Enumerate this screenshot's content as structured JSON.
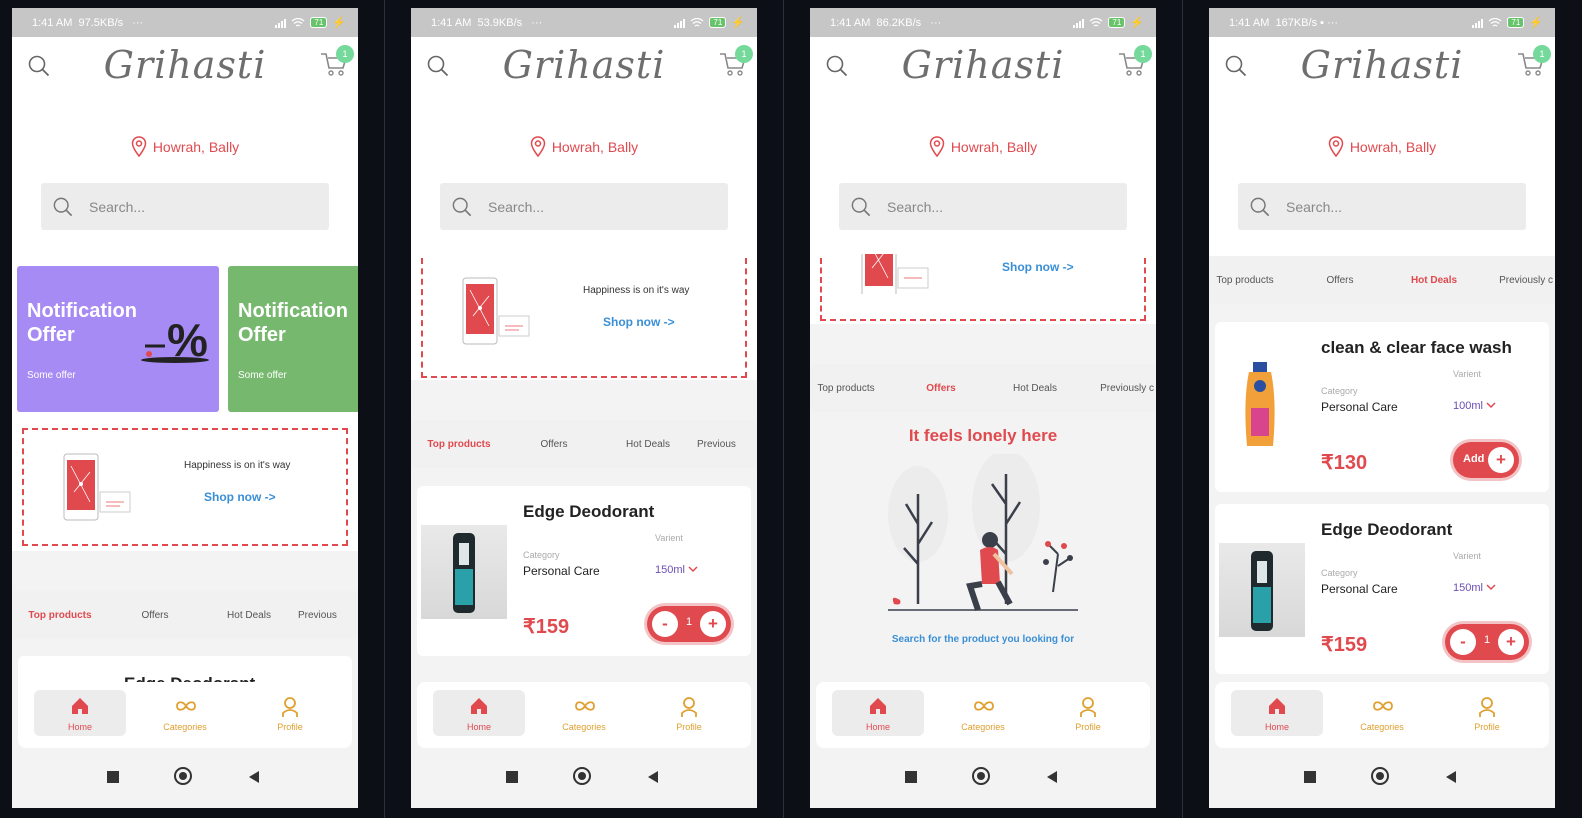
{
  "status_bars": [
    {
      "time": "1:41 AM",
      "speed": "97.5KB/s",
      "dots": "···",
      "battery": "71"
    },
    {
      "time": "1:41 AM",
      "speed": "53.9KB/s",
      "dots": "···",
      "battery": "71"
    },
    {
      "time": "1:41 AM",
      "speed": "86.2KB/s",
      "dots": "···",
      "battery": "71"
    },
    {
      "time": "1:41 AM",
      "speed": "167KB/s",
      "dots": "···",
      "battery": "71"
    }
  ],
  "app": {
    "logo": "Grihasti",
    "cart_count": "1",
    "location": "Howrah, Bally",
    "search_placeholder": "Search..."
  },
  "offers": [
    {
      "title": "Notification Offer",
      "subtitle": "Some offer",
      "color": "#a78bf4"
    },
    {
      "title": "Notification Offer",
      "subtitle": "Some offer",
      "color": "#76b86e"
    }
  ],
  "promo": {
    "text": "Happiness is on it's way",
    "link": "Shop now ->"
  },
  "tabs": [
    "Top products",
    "Offers",
    "Hot Deals",
    "Previously"
  ],
  "tabs_cut": {
    "s1": "Previous",
    "s2": "Previous",
    "s3": "Previously c",
    "s4": "Previously c"
  },
  "products": {
    "edge": {
      "name": "Edge Deodorant",
      "category_label": "Category",
      "category": "Personal Care",
      "variant_label": "Varient",
      "variant": "150ml",
      "price": "₹159",
      "qty": "1"
    },
    "clean": {
      "name": "clean & clear face wash",
      "category_label": "Category",
      "category": "Personal Care",
      "variant_label": "Varient",
      "variant": "100ml",
      "price": "₹130",
      "add_label": "Add"
    }
  },
  "empty_state": {
    "title": "It feels lonely here",
    "hint": "Search for the product you looking for"
  },
  "nav": {
    "home": "Home",
    "categories": "Categories",
    "profile": "Profile"
  },
  "colors": {
    "accent": "#e04a4f",
    "link": "#3a8fd6",
    "nav_label": "#e0a030",
    "variant": "#6b4fb5"
  }
}
